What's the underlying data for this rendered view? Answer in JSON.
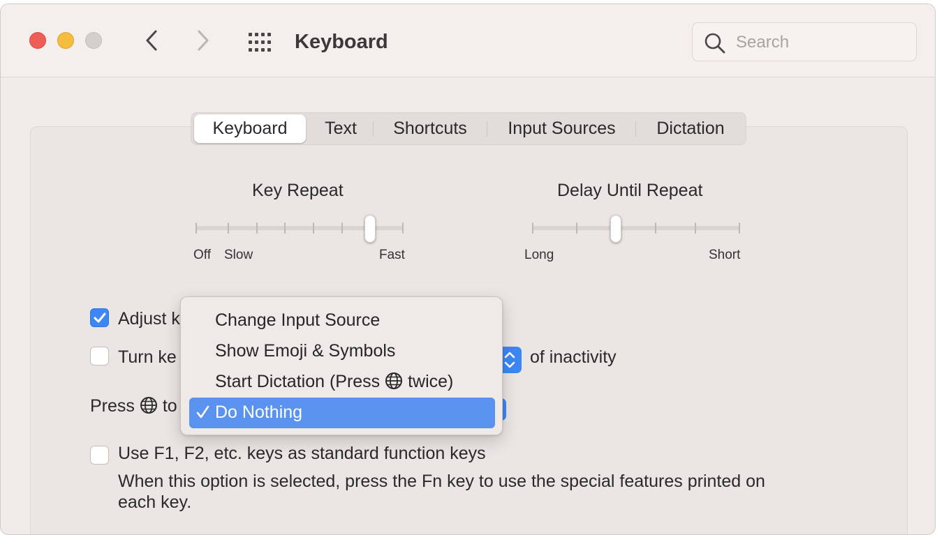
{
  "window": {
    "title": "Keyboard"
  },
  "search": {
    "placeholder": "Search"
  },
  "tabs": [
    {
      "label": "Keyboard",
      "active": true
    },
    {
      "label": "Text"
    },
    {
      "label": "Shortcuts"
    },
    {
      "label": "Input Sources"
    },
    {
      "label": "Dictation"
    }
  ],
  "key_repeat": {
    "title": "Key Repeat",
    "labels": {
      "off": "Off",
      "slow": "Slow",
      "fast": "Fast"
    },
    "value_step": 6,
    "steps": 8
  },
  "delay_until_repeat": {
    "title": "Delay Until Repeat",
    "labels": {
      "long": "Long",
      "short": "Short"
    },
    "value_step": 2,
    "steps": 6
  },
  "options": {
    "adjust_prefix": "Adjust k",
    "adjust_checked": true,
    "turn_prefix": "Turn ke",
    "turn_checked": false,
    "inactivity_suffix": "of inactivity",
    "press_globe_prefix": "Press",
    "press_globe_suffix": "to",
    "fn_keys_label": "Use F1, F2, etc. keys as standard function keys",
    "fn_keys_checked": false,
    "fn_keys_help_line1": "When this option is selected, press the Fn key to use the special features printed on",
    "fn_keys_help_line2": "each key."
  },
  "dropdown_menu": {
    "items": [
      {
        "label": "Change Input Source"
      },
      {
        "label": "Show Emoji & Symbols"
      },
      {
        "label_prefix": "Start Dictation (Press",
        "label_suffix": "twice)"
      },
      {
        "label": "Do Nothing",
        "selected": true
      }
    ],
    "check_mark": "✓"
  },
  "colors": {
    "accent": "#3d87f5",
    "menu_selection": "#5a93ef"
  }
}
